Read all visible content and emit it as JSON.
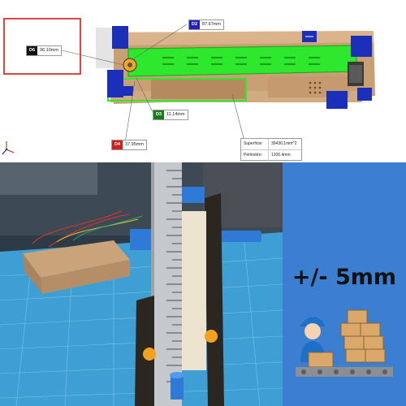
{
  "cad": {
    "dimensions": [
      {
        "tag": "D6",
        "value": "96.10mm",
        "tag_color": "#111111"
      },
      {
        "tag": "D2",
        "value": "87.67mm",
        "tag_color": "#2222bb"
      },
      {
        "tag": "D3",
        "value": "11.14mm",
        "tag_color": "#1a7a1a"
      },
      {
        "tag": "D4",
        "value": "37.95mm",
        "tag_color": "#d31d1d"
      }
    ],
    "measure_info": {
      "rows": [
        {
          "label": "Superficie:",
          "value": "39430.1mm^2"
        },
        {
          "label": "Périmètre:",
          "value": "1200.4mm"
        }
      ]
    },
    "axis_labels": {
      "y": "y",
      "x": "x",
      "z": "z"
    }
  },
  "callout": {
    "tolerance_text": "+/- 5mm"
  },
  "colors": {
    "panel_bg": "#3c7fd0",
    "green_highlight": "#2ee82e",
    "frame_blue": "#1b2fb8",
    "wood": "#c8a27a",
    "mat_blue": "#3d9fd4"
  },
  "icons": {
    "worker_illustration": "worker-boxes-icon",
    "ruler": "ruler-icon"
  }
}
